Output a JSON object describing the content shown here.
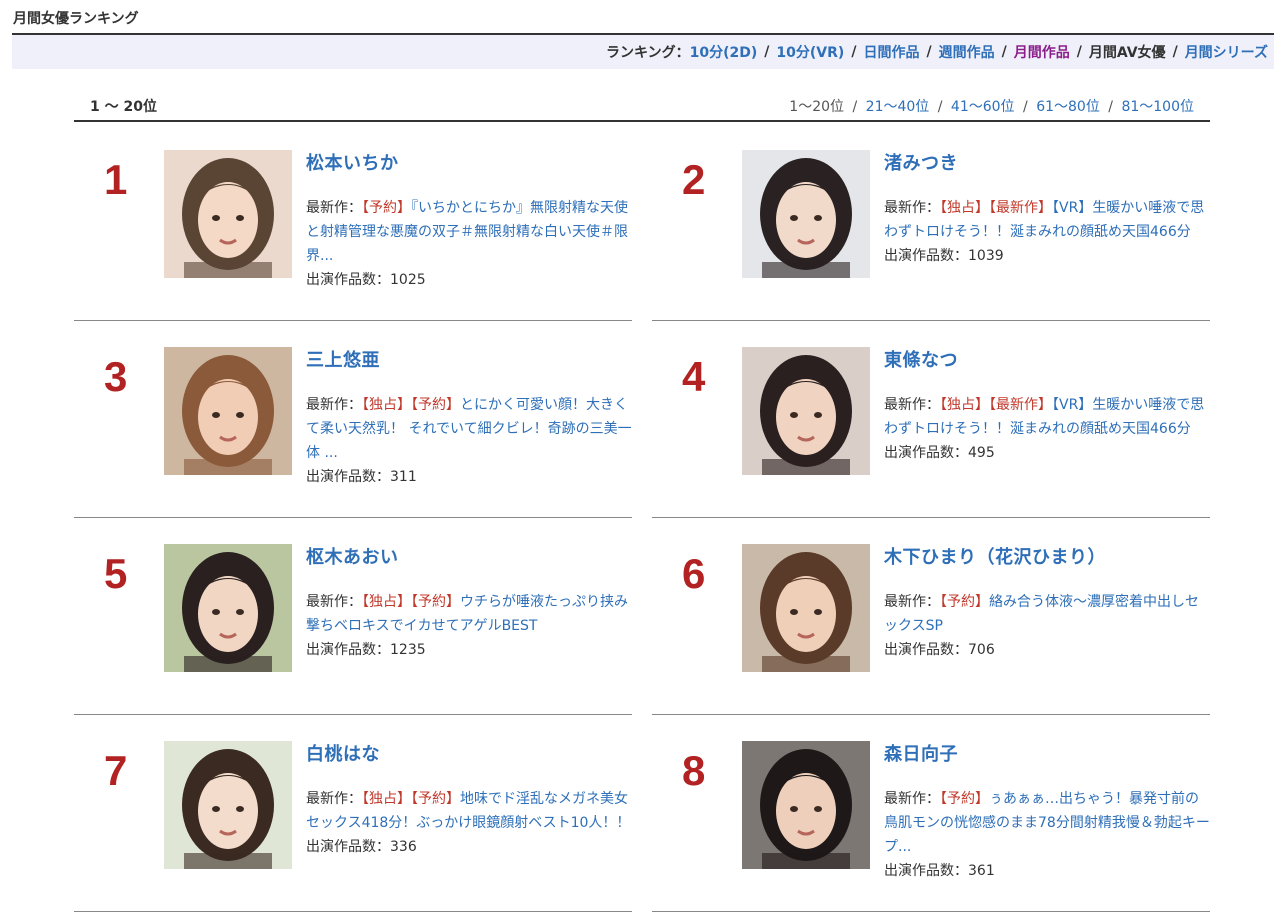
{
  "page_title": "月間女優ランキング",
  "nav": {
    "label": "ランキング：",
    "items": [
      {
        "label": "10分(2D)",
        "state": "link"
      },
      {
        "label": "10分(VR)",
        "state": "link"
      },
      {
        "label": "日間作品",
        "state": "link"
      },
      {
        "label": "週間作品",
        "state": "link"
      },
      {
        "label": "月間作品",
        "state": "visited"
      },
      {
        "label": "月間AV女優",
        "state": "current"
      },
      {
        "label": "月間シリーズ",
        "state": "link"
      }
    ],
    "separator": "/"
  },
  "range": {
    "current": "1 ～ 20位",
    "links": [
      {
        "label": "1～20位",
        "active": true
      },
      {
        "label": "21～40位",
        "active": false
      },
      {
        "label": "41～60位",
        "active": false
      },
      {
        "label": "61～80位",
        "active": false
      },
      {
        "label": "81～100位",
        "active": false
      }
    ],
    "separator": "/"
  },
  "latest_prefix": "最新作：",
  "count_prefix": "出演作品数：",
  "colors": {
    "link": "#2e6fb8",
    "rank": "#b22222",
    "tag": "#c0392b",
    "visited": "#8b1e8b"
  },
  "actresses": [
    {
      "rank": "1",
      "name": "松本いちか",
      "tags": [
        "【予約】"
      ],
      "title": "『いちかとにちか』無限射精な天使と射精管理な悪魔の双子＃無限射精な白い天使＃限界...",
      "count": "1025"
    },
    {
      "rank": "2",
      "name": "渚みつき",
      "tags": [
        "【独占】",
        "【最新作】"
      ],
      "blue_tag": "【VR】",
      "title": "生暖かい唾液で思わずトロけそう！！涎まみれの顔舐め天国466分",
      "count": "1039"
    },
    {
      "rank": "3",
      "name": "三上悠亜",
      "tags": [
        "【独占】",
        "【予約】"
      ],
      "title": "とにかく可愛い顔！大きくて柔い天然乳！ それでいて細クビレ！奇跡の三美一体 ...",
      "count": "311"
    },
    {
      "rank": "4",
      "name": "東條なつ",
      "tags": [
        "【独占】",
        "【最新作】"
      ],
      "blue_tag": "【VR】",
      "title": "生暖かい唾液で思わずトロけそう！！涎まみれの顔舐め天国466分",
      "count": "495"
    },
    {
      "rank": "5",
      "name": "枢木あおい",
      "tags": [
        "【独占】",
        "【予約】"
      ],
      "title": "ウチらが唾液たっぷり挟み撃ちベロキスでイカせてアゲルBEST",
      "count": "1235"
    },
    {
      "rank": "6",
      "name": "木下ひまり（花沢ひまり）",
      "tags": [
        "【予約】"
      ],
      "title": "絡み合う体液〜濃厚密着中出しセックスSP",
      "count": "706"
    },
    {
      "rank": "7",
      "name": "白桃はな",
      "tags": [
        "【独占】",
        "【予約】"
      ],
      "title": "地味でド淫乱なメガネ美女セックス418分！ぶっかけ眼鏡顔射ベスト10人！！",
      "count": "336"
    },
    {
      "rank": "8",
      "name": "森日向子",
      "tags": [
        "【予約】"
      ],
      "title": "ぅあぁぁ…出ちゃう！暴発寸前の鳥肌モンの恍惚感のまま78分間射精我慢＆勃起キープ...",
      "count": "361"
    }
  ]
}
